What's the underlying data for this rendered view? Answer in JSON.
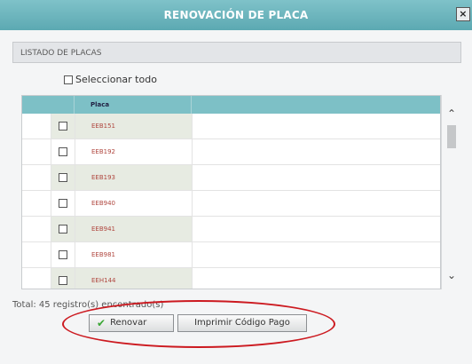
{
  "window": {
    "title": "RENOVACIÓN DE PLACA",
    "close_label": "×"
  },
  "section": {
    "title": "LISTADO DE PLACAS"
  },
  "select_all": {
    "label": "Seleccionar todo"
  },
  "table": {
    "column_header": "Placa",
    "rows": [
      {
        "placa": "EEB151"
      },
      {
        "placa": "EEB192"
      },
      {
        "placa": "EEB193"
      },
      {
        "placa": "EEB940"
      },
      {
        "placa": "EEB941"
      },
      {
        "placa": "EEB981"
      },
      {
        "placa": "EEH144"
      }
    ]
  },
  "footer": {
    "total_text": "Total: 45 registro(s) encontrado(s)"
  },
  "buttons": {
    "renovar_label": "Renovar",
    "imprimir_label": "Imprimir Código Pago"
  },
  "colors": {
    "titlebar": "#6db6bf",
    "header": "#7dc0c6",
    "annotation": "#cc1a20"
  }
}
